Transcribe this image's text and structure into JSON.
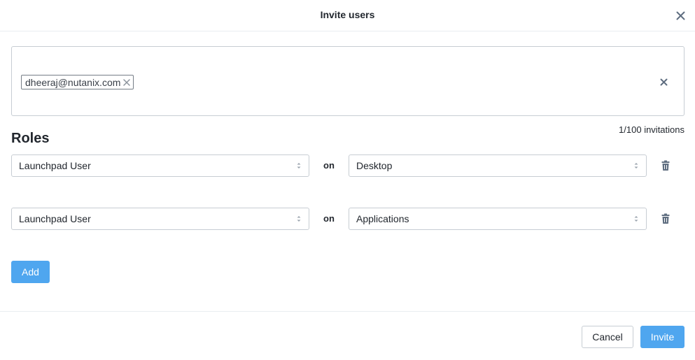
{
  "dialog": {
    "title": "Invite users"
  },
  "emails": {
    "chips": [
      {
        "label": "dheeraj@nutanix.com"
      }
    ],
    "count_text": "1/100 invitations"
  },
  "roles": {
    "title": "Roles",
    "rows": [
      {
        "role": "Launchpad User",
        "connector": "on",
        "scope": "Desktop"
      },
      {
        "role": "Launchpad User",
        "connector": "on",
        "scope": "Applications"
      }
    ],
    "add_label": "Add"
  },
  "footer": {
    "cancel_label": "Cancel",
    "invite_label": "Invite"
  },
  "colors": {
    "primary": "#4fa6ef",
    "text": "#22272e",
    "border": "#c7cdd3",
    "icon": "#5f6e80"
  },
  "icons": [
    "close-icon",
    "chip-remove-icon",
    "clear-icon",
    "select-caret-icon",
    "trash-icon"
  ]
}
